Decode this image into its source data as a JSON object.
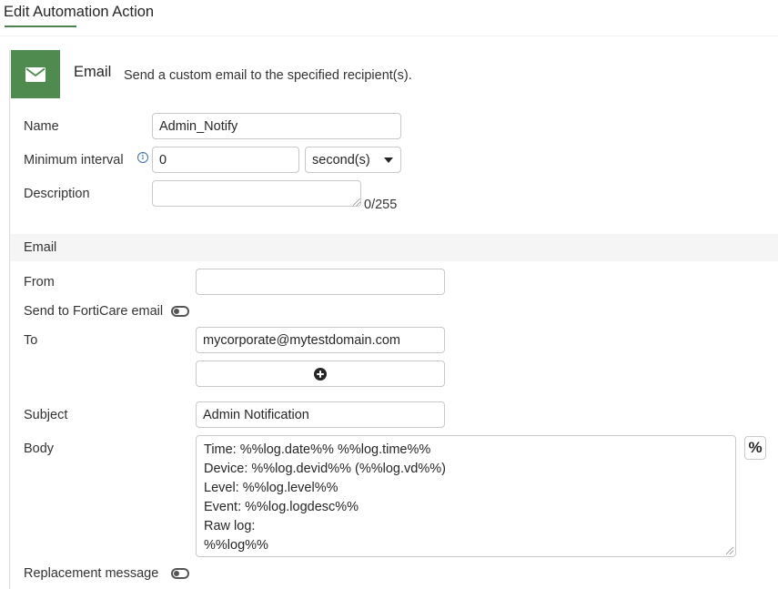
{
  "page": {
    "tab_title": "Edit Automation Action"
  },
  "action_type": {
    "title": "Email",
    "description": "Send a custom email to the specified recipient(s).",
    "icon": "envelope-icon",
    "accent_color": "#4f8a4f"
  },
  "general": {
    "name_label": "Name",
    "name_value": "Admin_Notify",
    "interval_label": "Minimum interval",
    "interval_value": "0",
    "interval_unit": "second(s)",
    "description_label": "Description",
    "description_value": "",
    "description_counter": "0/255"
  },
  "email": {
    "section_title": "Email",
    "from_label": "From",
    "from_value": "",
    "forticare_label": "Send to FortiCare email",
    "forticare_enabled": false,
    "to_label": "To",
    "to_values": [
      "mycorporate@mytestdomain.com"
    ],
    "subject_label": "Subject",
    "subject_value": "Admin Notification",
    "body_label": "Body",
    "body_value": "Time: %%log.date%% %%log.time%%\nDevice: %%log.devid%% (%%log.vd%%)\nLevel: %%log.level%%\nEvent: %%log.logdesc%%\nRaw log:\n%%log%%",
    "variable_button": "%",
    "replacement_label": "Replacement message",
    "replacement_enabled": false
  }
}
